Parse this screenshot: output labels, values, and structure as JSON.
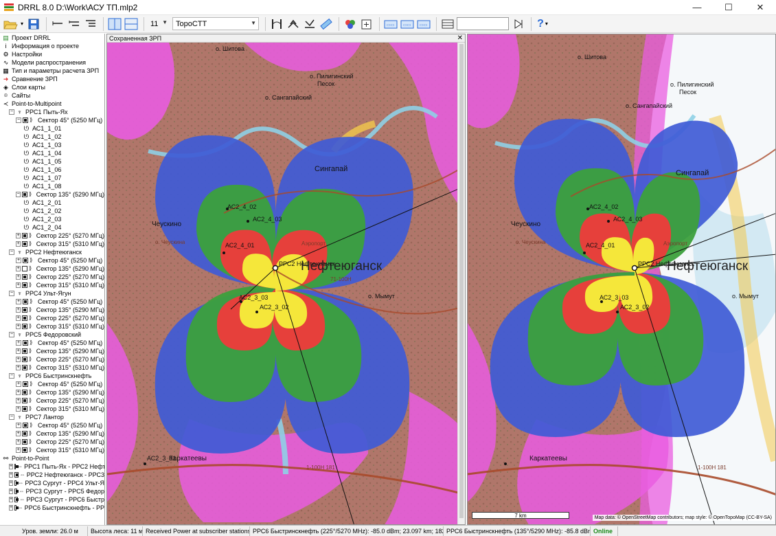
{
  "window": {
    "title": "DRRL 8.0 D:\\Work\\АСУ ТП.mlp2",
    "minimize": "—",
    "maximize": "☐",
    "close": "✕"
  },
  "toolbar": {
    "font_size": "11",
    "map_style": "TopoCTT",
    "search_value": ""
  },
  "sidebar": {
    "items": [
      {
        "indent": 0,
        "icon": "drrl-icon",
        "glyph": "▤",
        "label": "Проект DRRL"
      },
      {
        "indent": 0,
        "icon": "info-icon",
        "glyph": "i",
        "label": "Информация о проекте"
      },
      {
        "indent": 0,
        "icon": "gear-icon",
        "glyph": "⚙",
        "label": "Настройки"
      },
      {
        "indent": 0,
        "icon": "propagation-icon",
        "glyph": "∿",
        "label": "Модели распространения"
      },
      {
        "indent": 0,
        "icon": "params-icon",
        "glyph": "▦",
        "label": "Тип и параметры расчета ЗРП"
      },
      {
        "indent": 0,
        "icon": "arrow-right-icon",
        "glyph": "➜",
        "label": "Сравнение ЗРП",
        "selected": true
      },
      {
        "indent": 0,
        "icon": "layers-icon",
        "glyph": "◈",
        "label": "Слои карты"
      },
      {
        "indent": 0,
        "icon": "location-icon",
        "glyph": "⌾",
        "label": "Сайты"
      },
      {
        "indent": 0,
        "icon": "share-icon",
        "glyph": "≺",
        "label": "Point-to-Multipoint"
      },
      {
        "indent": 1,
        "pm": "−",
        "icon": "tower-icon",
        "glyph": "♆",
        "label": "РРС1 Пыть-Ях"
      },
      {
        "indent": 2,
        "pm": "−",
        "cb": true,
        "sig": true,
        "label": "Сектор 45° (5250 МГц)"
      },
      {
        "indent": 3,
        "icon": "subscriber-icon",
        "glyph": "ᘎ",
        "label": "АС1_1_01"
      },
      {
        "indent": 3,
        "icon": "subscriber-icon",
        "glyph": "ᘎ",
        "label": "АС1_1_02"
      },
      {
        "indent": 3,
        "icon": "subscriber-icon",
        "glyph": "ᘎ",
        "label": "АС1_1_03"
      },
      {
        "indent": 3,
        "icon": "subscriber-icon",
        "glyph": "ᘎ",
        "label": "АС1_1_04"
      },
      {
        "indent": 3,
        "icon": "subscriber-icon",
        "glyph": "ᘎ",
        "label": "АС1_1_05"
      },
      {
        "indent": 3,
        "icon": "subscriber-icon",
        "glyph": "ᘎ",
        "label": "АС1_1_06"
      },
      {
        "indent": 3,
        "icon": "subscriber-icon",
        "glyph": "ᘎ",
        "label": "АС1_1_07"
      },
      {
        "indent": 3,
        "icon": "subscriber-icon",
        "glyph": "ᘎ",
        "label": "АС1_1_08"
      },
      {
        "indent": 2,
        "pm": "−",
        "cb": true,
        "sig": true,
        "label": "Сектор 135° (5290 МГц)"
      },
      {
        "indent": 3,
        "icon": "subscriber-icon",
        "glyph": "ᘎ",
        "label": "АС1_2_01"
      },
      {
        "indent": 3,
        "icon": "subscriber-icon",
        "glyph": "ᘎ",
        "label": "АС1_2_02"
      },
      {
        "indent": 3,
        "icon": "subscriber-icon",
        "glyph": "ᘎ",
        "label": "АС1_2_03"
      },
      {
        "indent": 3,
        "icon": "subscriber-icon",
        "glyph": "ᘎ",
        "label": "АС1_2_04"
      },
      {
        "indent": 2,
        "pm": "+",
        "cb": true,
        "sig": true,
        "label": "Сектор 225° (5270 МГц)"
      },
      {
        "indent": 2,
        "pm": "+",
        "cb": true,
        "sig": true,
        "label": "Сектор 315° (5310 МГц)"
      },
      {
        "indent": 1,
        "pm": "−",
        "icon": "tower-icon",
        "glyph": "♆",
        "label": "РРС2 Нефтеюганск"
      },
      {
        "indent": 2,
        "pm": "+",
        "cb": true,
        "sig": true,
        "label": "Сектор 45° (5250 МГц)"
      },
      {
        "indent": 2,
        "pm": "+",
        "cb": false,
        "sig": true,
        "label": "Сектор 135° (5290 МГц)"
      },
      {
        "indent": 2,
        "pm": "+",
        "cb": true,
        "sig": true,
        "label": "Сектор 225° (5270 МГц)"
      },
      {
        "indent": 2,
        "pm": "+",
        "cb": true,
        "sig": true,
        "label": "Сектор 315° (5310 МГц)"
      },
      {
        "indent": 1,
        "pm": "−",
        "icon": "tower-icon",
        "glyph": "♆",
        "label": "РРС4 Ульт-Ягун"
      },
      {
        "indent": 2,
        "pm": "+",
        "cb": true,
        "sig": true,
        "label": "Сектор 45° (5250 МГц)"
      },
      {
        "indent": 2,
        "pm": "+",
        "cb": true,
        "sig": true,
        "label": "Сектор 135° (5290 МГц)"
      },
      {
        "indent": 2,
        "pm": "+",
        "cb": true,
        "sig": true,
        "label": "Сектор 225° (5270 МГц)"
      },
      {
        "indent": 2,
        "pm": "+",
        "cb": true,
        "sig": true,
        "label": "Сектор 315° (5310 МГц)"
      },
      {
        "indent": 1,
        "pm": "−",
        "icon": "tower-icon",
        "glyph": "♆",
        "label": "РРС5 Федоровский"
      },
      {
        "indent": 2,
        "pm": "+",
        "cb": true,
        "sig": true,
        "label": "Сектор 45° (5250 МГц)"
      },
      {
        "indent": 2,
        "pm": "+",
        "cb": true,
        "sig": true,
        "label": "Сектор 135° (5290 МГц)"
      },
      {
        "indent": 2,
        "pm": "+",
        "cb": true,
        "sig": true,
        "label": "Сектор 225° (5270 МГц)"
      },
      {
        "indent": 2,
        "pm": "+",
        "cb": true,
        "sig": true,
        "label": "Сектор 315° (5310 МГц)"
      },
      {
        "indent": 1,
        "pm": "−",
        "icon": "tower-icon",
        "glyph": "♆",
        "label": "РРС6 Быстринскнефть"
      },
      {
        "indent": 2,
        "pm": "+",
        "cb": true,
        "sig": true,
        "label": "Сектор 45° (5250 МГц)"
      },
      {
        "indent": 2,
        "pm": "+",
        "cb": true,
        "sig": true,
        "label": "Сектор 135° (5290 МГц)"
      },
      {
        "indent": 2,
        "pm": "+",
        "cb": true,
        "sig": true,
        "label": "Сектор 225° (5270 МГц)"
      },
      {
        "indent": 2,
        "pm": "+",
        "cb": true,
        "sig": true,
        "label": "Сектор 315° (5310 МГц)"
      },
      {
        "indent": 1,
        "pm": "−",
        "icon": "tower-icon",
        "glyph": "♆",
        "label": "РРС7 Лантор"
      },
      {
        "indent": 2,
        "pm": "+",
        "cb": true,
        "sig": true,
        "label": "Сектор 45° (5250 МГц)"
      },
      {
        "indent": 2,
        "pm": "+",
        "cb": true,
        "sig": true,
        "label": "Сектор 135° (5290 МГц)"
      },
      {
        "indent": 2,
        "pm": "+",
        "cb": true,
        "sig": true,
        "label": "Сектор 225° (5270 МГц)"
      },
      {
        "indent": 2,
        "pm": "+",
        "cb": true,
        "sig": true,
        "label": "Сектор 315° (5310 МГц)"
      },
      {
        "indent": 0,
        "icon": "link-icon",
        "glyph": "⚯",
        "label": "Point-to-Point"
      },
      {
        "indent": 1,
        "pm": "+",
        "cb": true,
        "link": true,
        "label": "РРС1 Пыть-Ях - РРС2 Нефт"
      },
      {
        "indent": 1,
        "pm": "+",
        "cb": true,
        "link": true,
        "label": "РРС2 Нефтеюганск - РРС3"
      },
      {
        "indent": 1,
        "pm": "+",
        "cb": true,
        "link": true,
        "label": "РРС3 Сургут - РРС4 Ульт-Я"
      },
      {
        "indent": 1,
        "pm": "+",
        "cb": true,
        "link": true,
        "label": "РРС3 Сургут - РРС5 Федор"
      },
      {
        "indent": 1,
        "pm": "+",
        "cb": true,
        "link": true,
        "label": "РРС3 Сургут - РРС6 Быстр"
      },
      {
        "indent": 1,
        "pm": "+",
        "cb": true,
        "link": true,
        "label": "РРС6 Быстринскнефть - РР"
      }
    ]
  },
  "left_map": {
    "header": "Сохраненная ЗРП",
    "close": "✕",
    "city": "Нефтеюганск",
    "labels": {
      "shitova": "о. Шитова",
      "piligin": "о. Пилигинский",
      "pesok": "Песок",
      "sangapai_island": "о. Сангапайский",
      "singapai": "Сингапай",
      "cheuskino": "Чеускино",
      "cheuskino_island": "о. Чеускина",
      "site": "РРС2 Нефтеюганск",
      "as2_4_02": "АС2_4_02",
      "as2_4_03": "АС2_4_03",
      "as2_4_01": "АС2_4_01",
      "as2_3_03": "АС2_3_03",
      "as2_3_02": "АС2_3_02",
      "as2_3_01": "АС2_3_01",
      "karkateevy": "Каркатеевы",
      "airport": "Аэропорт",
      "mymut": "о. Мымут",
      "road_1": "71-100Н",
      "road_2": "1-100Н 181"
    }
  },
  "right_map": {
    "city": "Нефтеюганск",
    "labels": {
      "shitova": "о. Шитова",
      "piligin": "о. Пилигинский",
      "pesok": "Песок",
      "sangapai_island": "о. Сангапайский",
      "singapai": "Сингапай",
      "cheuskino": "Чеускино",
      "cheuskino_island": "о. Чеускина",
      "site": "РРС2 Нефтеюганск",
      "as2_4_02": "АС2_4_02",
      "as2_4_03": "АС2_4_03",
      "as2_4_01": "АС2_4_01",
      "as2_3_03": "АС2_3_03",
      "as2_3_02": "АС2_3_02",
      "karkateevy": "Каркатеевы",
      "airport": "Аэропорт",
      "mymut": "о. Мымут",
      "road_2": "1-100Н 181"
    },
    "scale": "7 km",
    "attribution": "Map data: © OpenStreetMap contributors; map style: © OpenTopoMap (CC-BY-SA)"
  },
  "status": {
    "ground": "Уров. земли: 26.0 м",
    "forest": "Высота леса: 11 м",
    "received": "Received Power at subscriber stations",
    "left_value": "РРС6 Быстринскнефть (225°/5270 MHz): -85.0 dBm; 23.097 km; 182°",
    "right_value": "РРС6 Быстринскнефть (135°/5290 MHz): -85.8 dBm",
    "online": "Online"
  },
  "colors": {
    "magenta": "#e95de0",
    "brown": "#b0766a",
    "blue": "#3f5bd6",
    "green": "#3ca03c",
    "red": "#ef3b3b",
    "yellow": "#f5f03a",
    "accent_blue": "#2b6bd6"
  }
}
